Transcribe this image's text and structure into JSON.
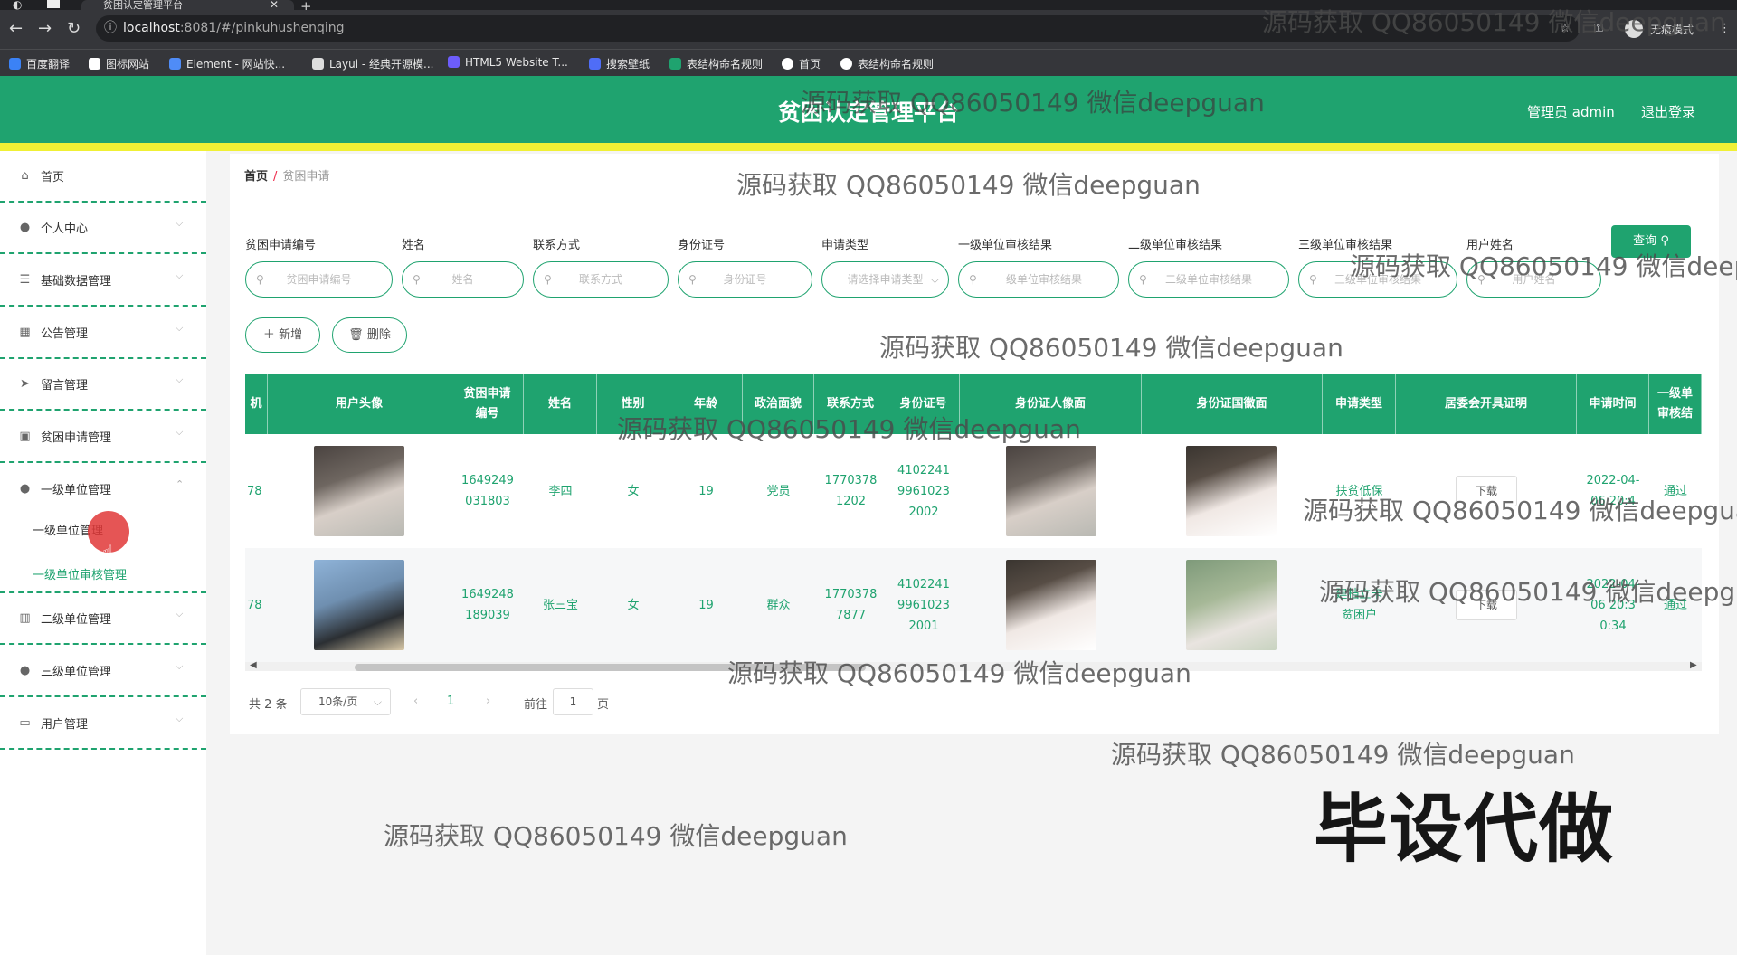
{
  "browser": {
    "tab_title": "贫困认定管理平台",
    "tab_close": "✕",
    "new_tab": "+",
    "url_host": "localhost",
    "url_rest": ":8081/#/pinkuhushenqing",
    "incognito_label": "无痕模式",
    "bookmarks": [
      "百度翻译",
      "图标网站",
      "Element - 网站快...",
      "Layui - 经典开源模...",
      "HTML5 Website T...",
      "搜索壁纸",
      "表结构命名规则",
      "首页",
      "表结构命名规则"
    ],
    "bookmark_colors": [
      "#3b82f6",
      "#ffffff",
      "#4f8cf7",
      "#dddddd",
      "#6d5dfc",
      "#4f6df7",
      "#1fa36f",
      "#ffffff",
      "#ffffff"
    ]
  },
  "header": {
    "title": "贫困认定管理平台",
    "admin": "管理员 admin",
    "logout": "退出登录",
    "accent": "#1fa36f",
    "stripe": "#f0f035"
  },
  "sidebar": {
    "items": [
      {
        "label": "首页",
        "icon": "home-icon"
      },
      {
        "label": "个人中心",
        "icon": "user-icon"
      },
      {
        "label": "基础数据管理",
        "icon": "list-icon"
      },
      {
        "label": "公告管理",
        "icon": "grid-icon"
      },
      {
        "label": "留言管理",
        "icon": "send-icon"
      },
      {
        "label": "贫困申请管理",
        "icon": "calendar-icon"
      },
      {
        "label": "一级单位管理",
        "icon": "user-icon"
      },
      {
        "label": "二级单位管理",
        "icon": "bar-chart-icon"
      },
      {
        "label": "三级单位管理",
        "icon": "user-icon"
      },
      {
        "label": "用户管理",
        "icon": "message-icon"
      }
    ],
    "submenu": [
      "一级单位管理",
      "一级单位审核管理"
    ]
  },
  "breadcrumb": {
    "home": "首页",
    "sep": "/",
    "current": "贫困申请"
  },
  "filters": [
    {
      "label": "贫困申请编号",
      "placeholder": "贫困申请编号"
    },
    {
      "label": "姓名",
      "placeholder": "姓名"
    },
    {
      "label": "联系方式",
      "placeholder": "联系方式"
    },
    {
      "label": "身份证号",
      "placeholder": "身份证号"
    },
    {
      "label": "申请类型",
      "placeholder": "请选择申请类型"
    },
    {
      "label": "一级单位审核结果",
      "placeholder": "一级单位审核结果"
    },
    {
      "label": "二级单位审核结果",
      "placeholder": "二级单位审核结果"
    },
    {
      "label": "三级单位审核结果",
      "placeholder": "三级单位审核结果"
    },
    {
      "label": "用户姓名",
      "placeholder": "用户姓名"
    }
  ],
  "buttons": {
    "query": "查询",
    "add": "新增",
    "delete": "删除"
  },
  "table": {
    "columns": [
      "机",
      "用户头像",
      "贫困申请编号",
      "姓名",
      "性别",
      "年龄",
      "政治面貌",
      "联系方式",
      "身份证号",
      "身份证人像面",
      "身份证国徽面",
      "申请类型",
      "居委会开具证明",
      "申请时间",
      "一级单审核结"
    ],
    "rows": [
      {
        "c0": "78",
        "id": "1649249031803",
        "name": "李四",
        "gender": "女",
        "age": "19",
        "politics": "党员",
        "phone": "17703781202",
        "idcard": "410224199610232002",
        "type": "扶贫低保",
        "download": "下载",
        "time": "2022-04-06 20:4",
        "result": "通过"
      },
      {
        "c0": "78",
        "id": "1649248189039",
        "name": "张三宝",
        "gender": "女",
        "age": "19",
        "politics": "群众",
        "phone": "17703787877",
        "idcard": "410224199610232001",
        "type": "建档立卡贫困户",
        "download": "下载",
        "time": "2022-04-06 20:30:34",
        "result": "通过"
      }
    ]
  },
  "pager": {
    "total": "共 2 条",
    "size": "10条/页",
    "prev": "‹",
    "page": "1",
    "next": "›",
    "goto": "前往",
    "goto_value": "1",
    "page_unit": "页"
  },
  "watermark": "源码获取 QQ86050149 微信deepguan",
  "overlay": "毕设代做"
}
